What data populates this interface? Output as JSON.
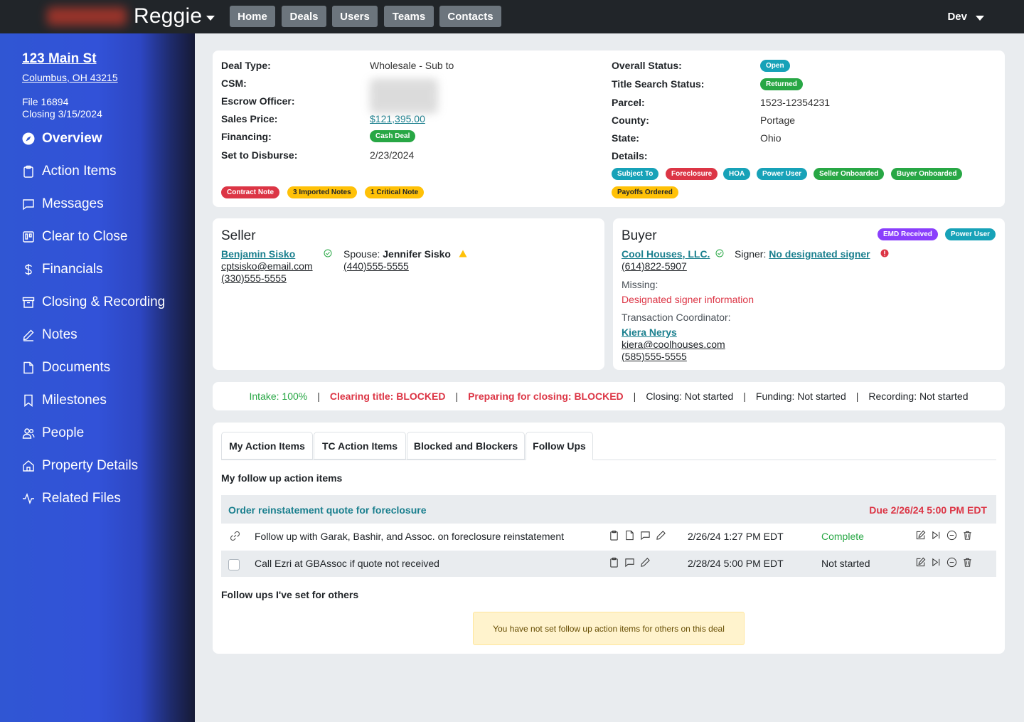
{
  "app": {
    "brand": "Reggie",
    "nav": [
      "Home",
      "Deals",
      "Users",
      "Teams",
      "Contacts"
    ],
    "env": "Dev"
  },
  "sidebar": {
    "address_line1": "123 Main St",
    "address_line2": "Columbus, OH 43215",
    "file": "File 16894",
    "closing": "Closing 3/15/2024",
    "items": [
      {
        "label": "Overview",
        "icon": "compass-icon"
      },
      {
        "label": "Action Items",
        "icon": "clipboard-icon"
      },
      {
        "label": "Messages",
        "icon": "chat-icon"
      },
      {
        "label": "Clear to Close",
        "icon": "kanban-icon"
      },
      {
        "label": "Financials",
        "icon": "dollar-icon"
      },
      {
        "label": "Closing & Recording",
        "icon": "archive-icon"
      },
      {
        "label": "Notes",
        "icon": "pencil-icon"
      },
      {
        "label": "Documents",
        "icon": "file-icon"
      },
      {
        "label": "Milestones",
        "icon": "bookmark-icon"
      },
      {
        "label": "People",
        "icon": "people-icon"
      },
      {
        "label": "Property Details",
        "icon": "house-icon"
      },
      {
        "label": "Related Files",
        "icon": "activity-icon"
      }
    ]
  },
  "deal": {
    "deal_type_label": "Deal Type:",
    "deal_type": "Wholesale - Sub to",
    "csm_label": "CSM:",
    "escrow_label": "Escrow Officer:",
    "sales_price_label": "Sales Price:",
    "sales_price": "$121,395.00",
    "financing_label": "Financing:",
    "financing": "Cash Deal",
    "disburse_label": "Set to Disburse:",
    "disburse": "2/23/2024",
    "overall_label": "Overall Status:",
    "overall": "Open",
    "title_search_label": "Title Search Status:",
    "title_search": "Returned",
    "parcel_label": "Parcel:",
    "parcel": "1523-12354231",
    "county_label": "County:",
    "county": "Portage",
    "state_label": "State:",
    "state": "Ohio",
    "details_label": "Details:",
    "details": [
      "Subject To",
      "Foreclosure",
      "HOA",
      "Power User",
      "Seller Onboarded",
      "Buyer Onboarded",
      "Payoffs Ordered"
    ],
    "notes": [
      "Contract Note",
      "3 Imported Notes",
      "1 Critical Note"
    ]
  },
  "seller": {
    "title": "Seller",
    "name": "Benjamin Sisko",
    "email": "cptsisko@email.com",
    "phone": "(330)555-5555",
    "spouse_label": "Spouse:",
    "spouse_name": "Jennifer Sisko",
    "spouse_phone": "(440)555-5555"
  },
  "buyer": {
    "title": "Buyer",
    "badges": [
      "EMD Received",
      "Power User"
    ],
    "name": "Cool Houses, LLC.",
    "phone": "(614)822-5907",
    "signer_label": "Signer:",
    "signer": "No designated signer",
    "missing_label": "Missing:",
    "missing": "Designated signer information",
    "tc_label": "Transaction Coordinator:",
    "tc_name": "Kiera Nerys",
    "tc_email": "kiera@coolhouses.com",
    "tc_phone": "(585)555-5555"
  },
  "progress": [
    {
      "text": "Intake: 100%",
      "color": "#28a745"
    },
    {
      "text": "Clearing title: BLOCKED",
      "color": "#dc3545"
    },
    {
      "text": "Preparing for closing: BLOCKED",
      "color": "#dc3545"
    },
    {
      "text": "Closing: Not started",
      "color": "#212529"
    },
    {
      "text": "Funding: Not started",
      "color": "#212529"
    },
    {
      "text": "Recording: Not started",
      "color": "#212529"
    }
  ],
  "tabs": [
    "My Action Items",
    "TC Action Items",
    "Blocked and Blockers",
    "Follow Ups"
  ],
  "followups": {
    "mine_heading": "My follow up action items",
    "group_title": "Order reinstatement quote for foreclosure",
    "group_due": "Due 2/26/24 5:00 PM EDT",
    "rows": [
      {
        "text": "Follow up with Garak, Bashir, and Assoc. on foreclosure reinstatement",
        "date": "2/26/24 1:27 PM EDT",
        "status": "Complete",
        "status_color": "#28a745"
      },
      {
        "text": "Call Ezri at GBAssoc if quote not received",
        "date": "2/28/24 5:00 PM EDT",
        "status": "Not started",
        "status_color": "#212529"
      }
    ],
    "others_heading": "Follow ups I've set for others",
    "others_empty": "You have not set follow up action items for others on this deal"
  }
}
